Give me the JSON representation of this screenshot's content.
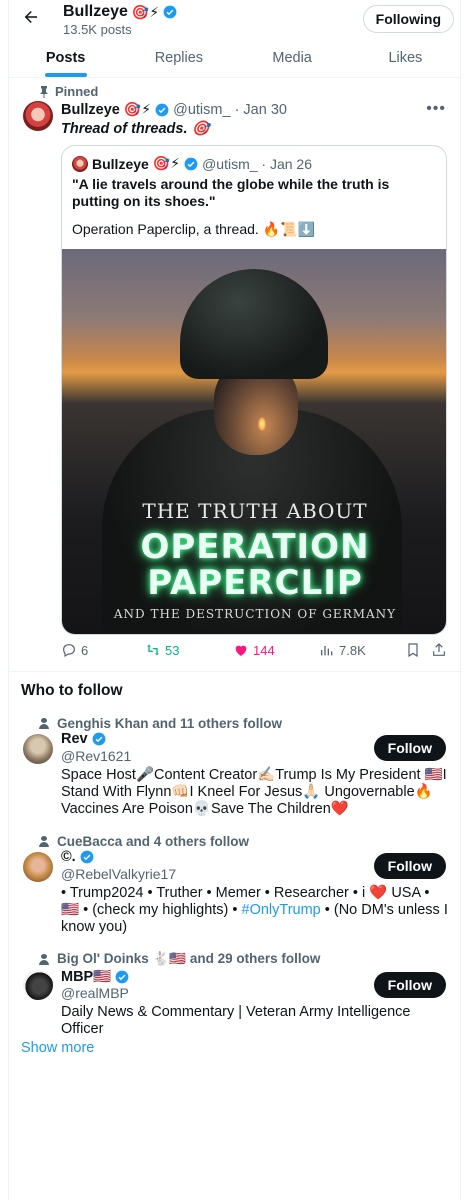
{
  "profile": {
    "name": "Bullzeye",
    "name_emojis": "🎯⚡",
    "posts_count": "13.5K posts",
    "following_label": "Following"
  },
  "tabs": [
    {
      "label": "Posts",
      "active": true
    },
    {
      "label": "Replies",
      "active": false
    },
    {
      "label": "Media",
      "active": false
    },
    {
      "label": "Likes",
      "active": false
    }
  ],
  "pinned_tweet": {
    "pinned_label": "Pinned",
    "author": "Bullzeye",
    "author_emojis": "🎯⚡",
    "handle_date": "@utism_ · Jan 30",
    "text": "Thread of threads. 🎯",
    "quote": {
      "author": "Bullzeye",
      "author_emojis": "🎯⚡",
      "handle_date": "@utism_ · Jan 26",
      "text1": "\"A lie travels around the globe while the truth is putting on its shoes.\"",
      "text2": "Operation Paperclip, a thread. 🔥📜⬇️",
      "image": {
        "title1": "THE TRUTH ABOUT",
        "title2": "OPERATION PAPERCLIP",
        "title3": "AND THE DESTRUCTION OF GERMANY"
      }
    },
    "stats": {
      "replies": "6",
      "reposts": "53",
      "likes": "144",
      "views": "7.8K"
    }
  },
  "who_to_follow": {
    "heading": "Who to follow",
    "follow_label": "Follow",
    "show_more": "Show more",
    "suggestions": [
      {
        "social": "Genghis Khan and 11 others follow",
        "name": "Rev",
        "handle": "@Rev1621",
        "bio": "Space Host🎤Content Creator✍🏻Trump Is My President 🇺🇸I Stand With Flynn👊🏻I Kneel For Jesus🙏🏻 Ungovernable🔥 Vaccines Are Poison💀Save The Children❤️"
      },
      {
        "social": "CueBacca and 4 others follow",
        "name": "©.",
        "handle": "@RebelValkyrie17",
        "bio_before": "• Trump2024 • Truther • Memer • Researcher • i ❤️ USA • 🇺🇸 • (check my highlights) • ",
        "bio_link": "#OnlyTrump",
        "bio_after": " • (No DM's unless I know you)"
      },
      {
        "social": "Big Ol' Doinks 🐇🇺🇸 and 29 others follow",
        "name": "MBP🇺🇸",
        "handle": "@realMBP",
        "bio": "Daily News & Commentary | Veteran Army Intelligence Officer"
      }
    ]
  },
  "colors": {
    "accent": "#1d9bf0",
    "like": "#f91880",
    "repost": "#00ba7c",
    "text": "#0f1419",
    "muted": "#536471"
  }
}
